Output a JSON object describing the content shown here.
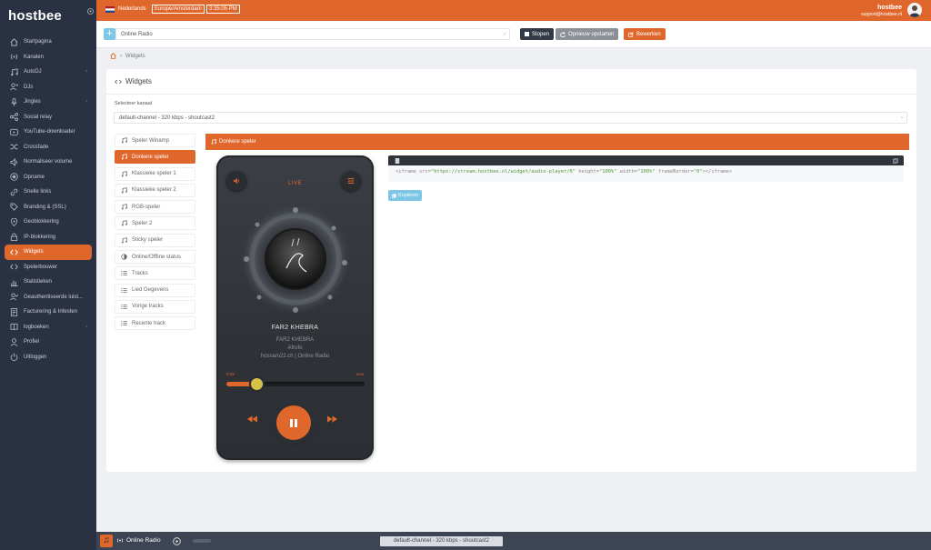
{
  "app": {
    "logo": "hostbee"
  },
  "sidebar": {
    "items": [
      {
        "label": "Startpagina",
        "icon": "home-icon"
      },
      {
        "label": "Kanalen",
        "icon": "broadcast-icon"
      },
      {
        "label": "AutoDJ",
        "icon": "music-icon",
        "chevron": true
      },
      {
        "label": "DJs",
        "icon": "user-plus-icon"
      },
      {
        "label": "Jingles",
        "icon": "microphone-icon",
        "chevron": true
      },
      {
        "label": "Social relay",
        "icon": "share-icon"
      },
      {
        "label": "YouTube-downloader",
        "icon": "youtube-icon"
      },
      {
        "label": "Crossfade",
        "icon": "shuffle-icon"
      },
      {
        "label": "Normaliseer volume",
        "icon": "volume-icon"
      },
      {
        "label": "Opname",
        "icon": "record-icon"
      },
      {
        "label": "Snelle links",
        "icon": "link-icon"
      },
      {
        "label": "Branding & (SSL)",
        "icon": "tag-icon"
      },
      {
        "label": "Geoblokkering",
        "icon": "location-icon"
      },
      {
        "label": "IP-blokkering",
        "icon": "lock-icon"
      },
      {
        "label": "Widgets",
        "icon": "code-icon",
        "active": true
      },
      {
        "label": "Spelerbouwer",
        "icon": "code-icon"
      },
      {
        "label": "Statistieken",
        "icon": "bar-chart-icon"
      },
      {
        "label": "Geauthentiseerde luist...",
        "icon": "user-check-icon"
      },
      {
        "label": "Facturering & Infesten",
        "icon": "invoice-icon"
      },
      {
        "label": "logboeken",
        "icon": "book-icon",
        "chevron": true
      },
      {
        "label": "Profiel",
        "icon": "user-icon"
      },
      {
        "label": "Uitloggen",
        "icon": "power-icon"
      }
    ]
  },
  "topbar": {
    "country": "Nederlands",
    "timezone": "Europe/Amsterdam",
    "clock": "3:35:05 PM",
    "user_name": "hostbee",
    "user_email": "support@hostbee.nl"
  },
  "station": {
    "selected": "Online Radio",
    "add_label": "+",
    "stop_label": "Stopen",
    "restart_label": "Opnieuw opstarten",
    "edit_label": "Bewerken"
  },
  "breadcrumb": {
    "current": "Widgets"
  },
  "card": {
    "title": "Widgets",
    "channel_label": "Selecteer kanaal",
    "channel_value": "default-channel - 320 kbps - shoutcast2"
  },
  "widgets": {
    "items": [
      {
        "label": "Speler Winamp",
        "icon": "music-icon"
      },
      {
        "label": "Donkere speler",
        "icon": "music-icon",
        "active": true
      },
      {
        "label": "Klassieke speler 1",
        "icon": "music-icon"
      },
      {
        "label": "Klassieke speler 2",
        "icon": "music-icon"
      },
      {
        "label": "RGB-speler",
        "icon": "music-icon"
      },
      {
        "label": "Speler 2",
        "icon": "music-icon"
      },
      {
        "label": "Sticky speler",
        "icon": "music-icon"
      },
      {
        "label": "Online/Offline status",
        "icon": "half-circle-icon"
      },
      {
        "label": "Tracks",
        "icon": "list-icon"
      },
      {
        "label": "Lied Gegevens",
        "icon": "list-icon"
      },
      {
        "label": "Vorige tracks",
        "icon": "list-icon"
      },
      {
        "label": "Recente track",
        "icon": "list-icon"
      }
    ]
  },
  "panel": {
    "title": "Donkere speler"
  },
  "player": {
    "live_label": "LIVE",
    "title": "FAR2 KHEBRA",
    "artist": "FAR2 KHEBRA",
    "album": "Afrofo",
    "station": "hossam22.ch | Online Radio",
    "elapsed": "0:29",
    "live_text": "Live",
    "progress": 0.22
  },
  "code": {
    "tag_open": "<iframe ",
    "src_attr": "src=",
    "src_val": "\"https://stream.hostbee.nl/widget/audio-player/6\"",
    "height_attr": " height=",
    "height_val": "\"100%\"",
    "width_attr": " width=",
    "width_val": "\"100%\"",
    "fb_attr": " frameBorder=",
    "fb_val": "\"0\"",
    "tag_close": "></iframe>"
  },
  "copy_button": {
    "label": "Kopiëren"
  },
  "bottombar": {
    "station": "Online Radio",
    "channel": "default-channel - 320 kbps - shoutcast2"
  },
  "colors": {
    "accent": "#e0672c",
    "sidebar": "#2a3142",
    "info": "#7dc7e6"
  }
}
